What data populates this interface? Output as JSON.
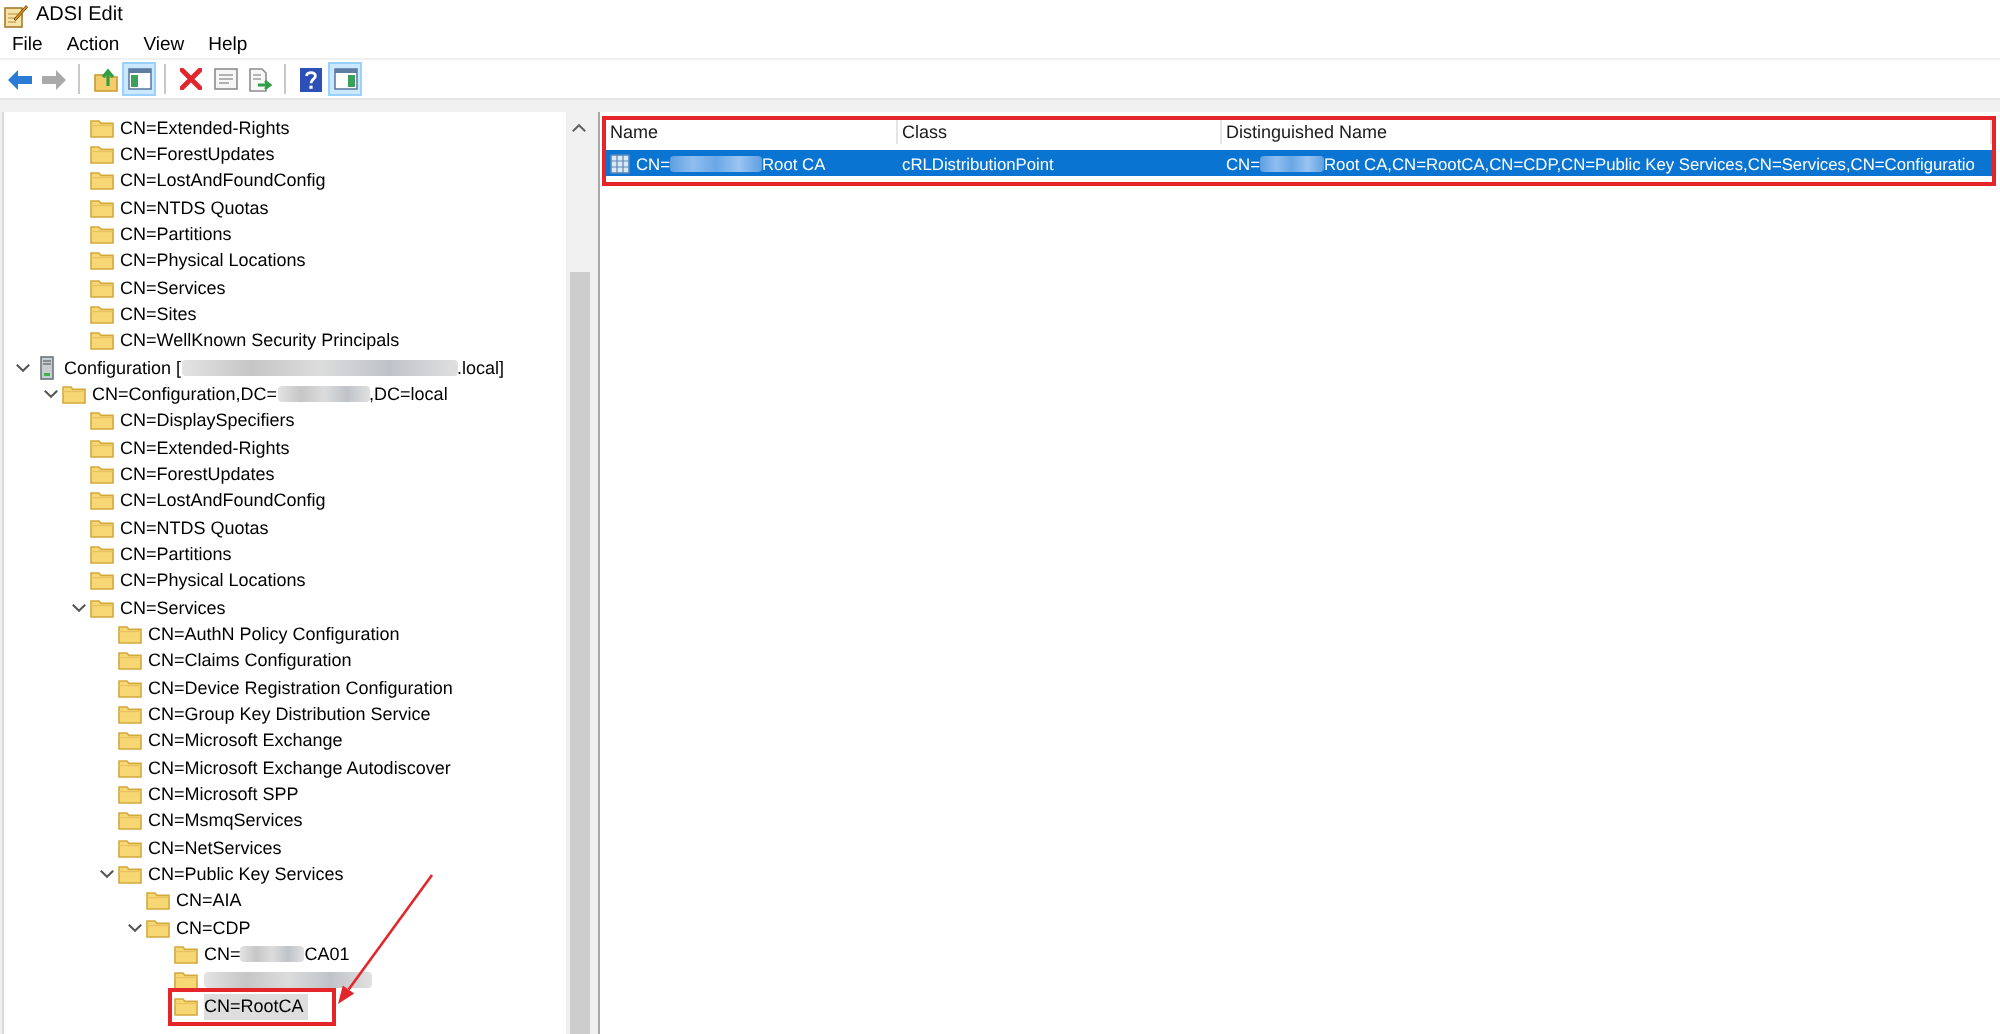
{
  "window": {
    "title": "ADSI Edit"
  },
  "menu": [
    {
      "label": "File"
    },
    {
      "label": "Action"
    },
    {
      "label": "View"
    },
    {
      "label": "Help"
    }
  ],
  "toolbar": [
    {
      "kind": "back",
      "disabled": false,
      "on": false
    },
    {
      "kind": "forward",
      "disabled": true,
      "on": false
    },
    {
      "kind": "separator"
    },
    {
      "kind": "up",
      "disabled": false,
      "on": false
    },
    {
      "kind": "console_tree",
      "disabled": false,
      "on": true
    },
    {
      "kind": "separator"
    },
    {
      "kind": "delete",
      "disabled": false,
      "on": false
    },
    {
      "kind": "properties",
      "disabled": false,
      "on": false
    },
    {
      "kind": "export",
      "disabled": false,
      "on": false
    },
    {
      "kind": "separator"
    },
    {
      "kind": "help",
      "disabled": false,
      "on": false
    },
    {
      "kind": "action_pane",
      "disabled": false,
      "on": true
    }
  ],
  "tree": {
    "nodes": [
      {
        "children": [
          {
            "children": [
              {
                "kind": "container",
                "label": "CN=Extended-Rights",
                "selected": false
              },
              {
                "kind": "container",
                "label": "CN=ForestUpdates",
                "selected": false
              },
              {
                "kind": "container",
                "label": "CN=LostAndFoundConfig",
                "selected": false
              },
              {
                "kind": "container",
                "label": "CN=NTDS Quotas",
                "selected": false
              },
              {
                "kind": "container",
                "label": "CN=Partitions",
                "selected": false
              },
              {
                "kind": "container",
                "label": "CN=Physical Locations",
                "selected": false
              },
              {
                "kind": "container",
                "label": "CN=Services",
                "selected": false
              },
              {
                "kind": "container",
                "label": "CN=Sites",
                "selected": false
              },
              {
                "kind": "container",
                "label": "CN=WellKnown Security Principals",
                "selected": false
              }
            ]
          }
        ]
      },
      {
        "kind": "naming_context",
        "parts": [
          {
            "kind": "text",
            "text": "Configuration ["
          },
          {
            "kind": "blur_wide"
          },
          {
            "kind": "text",
            "text": ".local]"
          }
        ],
        "selected": false,
        "expanded": true,
        "children": [
          {
            "kind": "container",
            "parts": [
              {
                "kind": "text",
                "text": "CN=Configuration,DC="
              },
              {
                "kind": "blur_medium"
              },
              {
                "kind": "text",
                "text": ",DC=local"
              }
            ],
            "selected": false,
            "expanded": true,
            "children": [
              {
                "kind": "container",
                "label": "CN=DisplaySpecifiers",
                "selected": false
              },
              {
                "kind": "container",
                "label": "CN=Extended-Rights",
                "selected": false
              },
              {
                "kind": "container",
                "label": "CN=ForestUpdates",
                "selected": false
              },
              {
                "kind": "container",
                "label": "CN=LostAndFoundConfig",
                "selected": false
              },
              {
                "kind": "container",
                "label": "CN=NTDS Quotas",
                "selected": false
              },
              {
                "kind": "container",
                "label": "CN=Partitions",
                "selected": false
              },
              {
                "kind": "container",
                "label": "CN=Physical Locations",
                "selected": false
              },
              {
                "kind": "container",
                "label": "CN=Services",
                "selected": false,
                "expanded": true,
                "children": [
                  {
                    "kind": "container",
                    "label": "CN=AuthN Policy Configuration",
                    "selected": false
                  },
                  {
                    "kind": "container",
                    "label": "CN=Claims Configuration",
                    "selected": false
                  },
                  {
                    "kind": "container",
                    "label": "CN=Device Registration Configuration",
                    "selected": false
                  },
                  {
                    "kind": "container",
                    "label": "CN=Group Key Distribution Service",
                    "selected": false
                  },
                  {
                    "kind": "container",
                    "label": "CN=Microsoft Exchange",
                    "selected": false
                  },
                  {
                    "kind": "container",
                    "label": "CN=Microsoft Exchange Autodiscover",
                    "selected": false
                  },
                  {
                    "kind": "container",
                    "label": "CN=Microsoft SPP",
                    "selected": false
                  },
                  {
                    "kind": "container",
                    "label": "CN=MsmqServices",
                    "selected": false
                  },
                  {
                    "kind": "container",
                    "label": "CN=NetServices",
                    "selected": false
                  },
                  {
                    "kind": "container",
                    "label": "CN=Public Key Services",
                    "selected": false,
                    "expanded": true,
                    "children": [
                      {
                        "kind": "container",
                        "label": "CN=AIA",
                        "selected": false
                      },
                      {
                        "kind": "container",
                        "label": "CN=CDP",
                        "selected": false,
                        "expanded": true,
                        "children": [
                          {
                            "kind": "container",
                            "parts": [
                              {
                                "kind": "text",
                                "text": "CN="
                              },
                              {
                                "kind": "blur_short"
                              },
                              {
                                "kind": "text",
                                "text": "CA01"
                              }
                            ],
                            "selected": false
                          },
                          {
                            "kind": "container",
                            "parts": [
                              {
                                "kind": "blur_long"
                              }
                            ],
                            "selected": false
                          },
                          {
                            "kind": "container",
                            "label": "CN=RootCA",
                            "selected": true,
                            "boxed": true,
                            "arrow": true
                          }
                        ]
                      }
                    ]
                  }
                ]
              }
            ]
          }
        ]
      }
    ]
  },
  "list": {
    "boxed": true,
    "columns": [
      {
        "label": "Name"
      },
      {
        "label": "Class"
      },
      {
        "label": "Distinguished Name"
      }
    ],
    "rows": [
      {
        "selected": true,
        "cells": [
          {
            "parts": [
              {
                "kind": "text",
                "text": "CN="
              },
              {
                "kind": "blur_medium"
              },
              {
                "kind": "text",
                "text": " Root CA"
              }
            ]
          },
          {
            "parts": [
              {
                "kind": "text",
                "text": "cRLDistributionPoint"
              }
            ]
          },
          {
            "parts": [
              {
                "kind": "text",
                "text": "CN="
              },
              {
                "kind": "blur_short"
              },
              {
                "kind": "text",
                "text": " Root CA,CN=RootCA,CN=CDP,CN=Public Key Services,CN=Services,CN=Configuratio"
              }
            ]
          }
        ]
      }
    ]
  }
}
